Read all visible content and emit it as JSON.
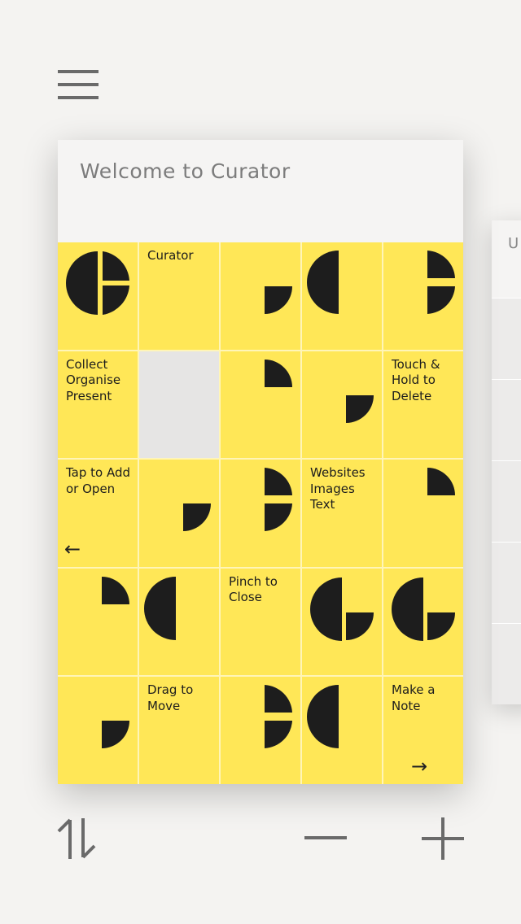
{
  "app": {
    "title": "Welcome to Curator"
  },
  "side_card": {
    "title_fragment": "U"
  },
  "tiles": [
    {
      "label": ""
    },
    {
      "label": "Curator"
    },
    {
      "label": ""
    },
    {
      "label": ""
    },
    {
      "label": ""
    },
    {
      "label": "Collect\nOrganise\nPresent"
    },
    {
      "label": ""
    },
    {
      "label": ""
    },
    {
      "label": ""
    },
    {
      "label": "Touch &\nHold to\nDelete"
    },
    {
      "label": "Tap to Add\nor Open"
    },
    {
      "label": ""
    },
    {
      "label": ""
    },
    {
      "label": "Websites\nImages\nText"
    },
    {
      "label": ""
    },
    {
      "label": ""
    },
    {
      "label": ""
    },
    {
      "label": "Pinch to\nClose"
    },
    {
      "label": ""
    },
    {
      "label": ""
    },
    {
      "label": ""
    },
    {
      "label": "Drag to\nMove"
    },
    {
      "label": ""
    },
    {
      "label": ""
    },
    {
      "label": "Make a\nNote"
    }
  ],
  "arrows": {
    "left": "←",
    "right": "→"
  },
  "colors": {
    "tile": "#ffe757",
    "ink": "#1d1d1d",
    "background": "#f4f3f1"
  },
  "icons": {
    "menu": "hamburger-icon",
    "sort": "sort-arrows-icon",
    "zoom_out": "minus-icon",
    "zoom_in": "plus-icon"
  }
}
